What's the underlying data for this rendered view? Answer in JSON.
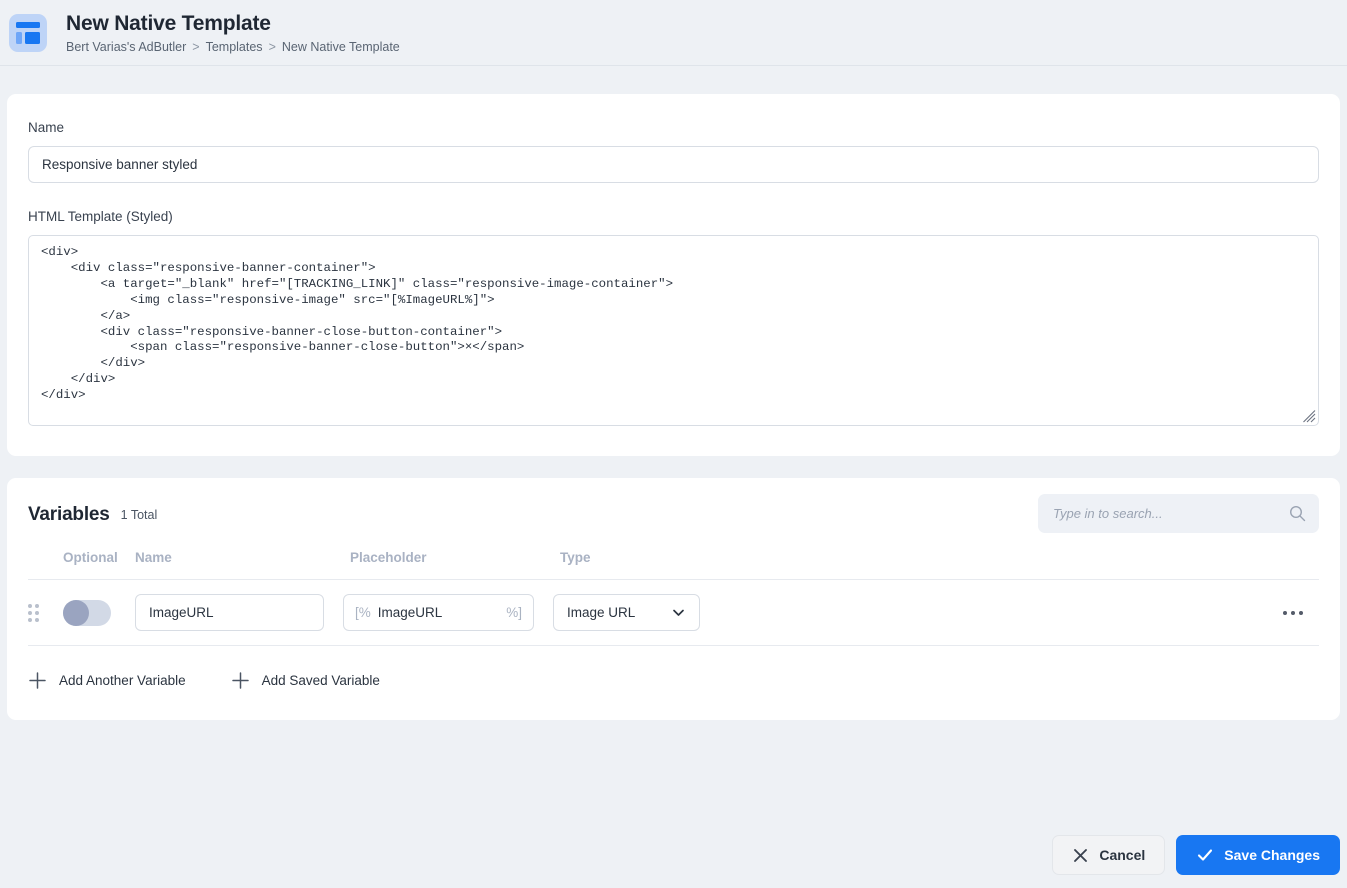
{
  "header": {
    "icon": "template-layout-icon",
    "title": "New Native Template",
    "breadcrumb": [
      "Bert Varias's AdButler",
      "Templates",
      "New Native Template"
    ],
    "separator": ">"
  },
  "form": {
    "name_label": "Name",
    "name_value": "Responsive banner styled",
    "name_placeholder": "",
    "html_label": "HTML Template (Styled)",
    "html_value": "<div>\n    <div class=\"responsive-banner-container\">\n        <a target=\"_blank\" href=\"[TRACKING_LINK]\" class=\"responsive-image-container\">\n            <img class=\"responsive-image\" src=\"[%ImageURL%]\">\n        </a>\n        <div class=\"responsive-banner-close-button-container\">\n            <span class=\"responsive-banner-close-button\">×</span>\n        </div>\n    </div>\n</div>"
  },
  "variables": {
    "title": "Variables",
    "count_text": "1 Total",
    "search_placeholder": "Type in to search...",
    "search_value": "",
    "search_icon": "search-icon",
    "columns": {
      "optional": "Optional",
      "name": "Name",
      "placeholder": "Placeholder",
      "type": "Type"
    },
    "rows": [
      {
        "optional_on": false,
        "name": "ImageURL",
        "placeholder_prefix": "[%",
        "placeholder_value": "ImageURL",
        "placeholder_suffix": "%]",
        "type": "Image URL"
      }
    ],
    "add_another_label": "Add Another Variable",
    "add_saved_label": "Add Saved Variable"
  },
  "footer": {
    "cancel_label": "Cancel",
    "save_label": "Save Changes",
    "accent_color": "#1877f2"
  }
}
